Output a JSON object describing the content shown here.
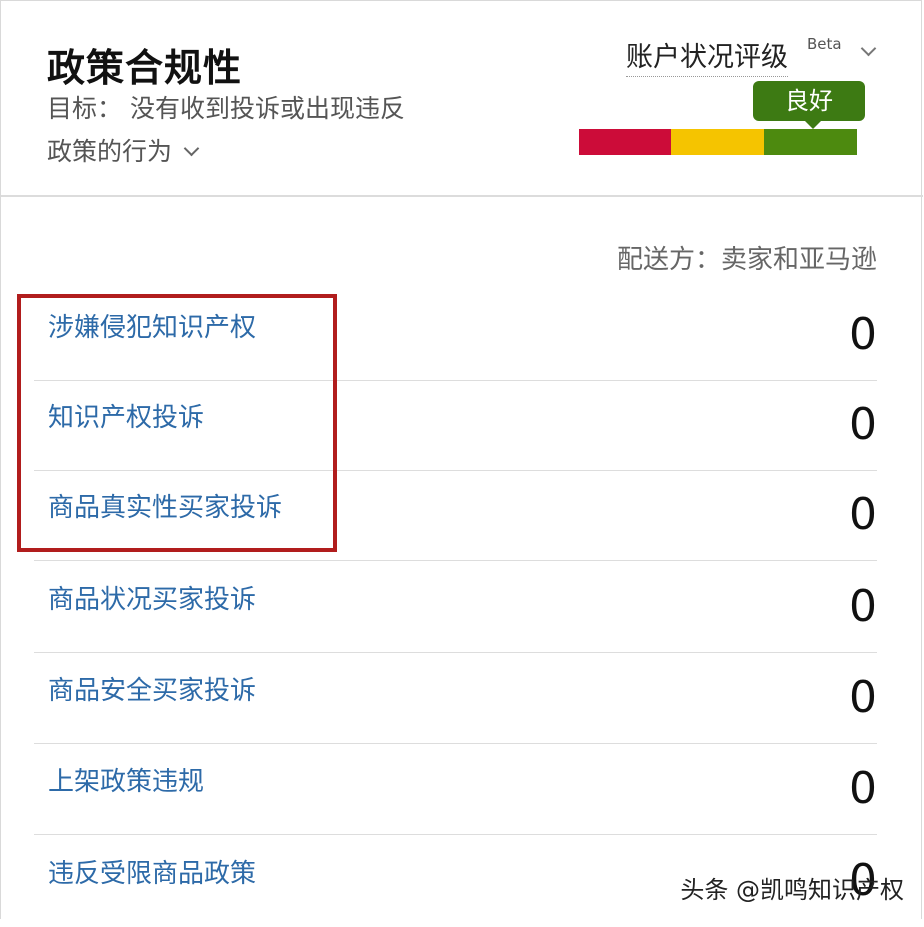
{
  "header": {
    "title": "政策合规性",
    "goal_line1": "目标： 没有收到投诉或出现违反",
    "goal_line2": "政策的行为",
    "rating_label": "账户状况评级",
    "beta_label": "Beta",
    "rating_value": "良好"
  },
  "colors": {
    "bad": "#cc0c39",
    "fair": "#f5c400",
    "good": "#4d8a0f",
    "link": "#2d6aa8",
    "highlight": "#b11d1d"
  },
  "shipped_by": "配送方：卖家和亚马逊",
  "rows": [
    {
      "label": "涉嫌侵犯知识产权",
      "count": "0"
    },
    {
      "label": "知识产权投诉",
      "count": "0"
    },
    {
      "label": "商品真实性买家投诉",
      "count": "0"
    },
    {
      "label": "商品状况买家投诉",
      "count": "0"
    },
    {
      "label": "商品安全买家投诉",
      "count": "0"
    },
    {
      "label": "上架政策违规",
      "count": "0"
    },
    {
      "label": "违反受限商品政策",
      "count": "0"
    }
  ],
  "watermark": "头条 @凯鸣知识产权"
}
